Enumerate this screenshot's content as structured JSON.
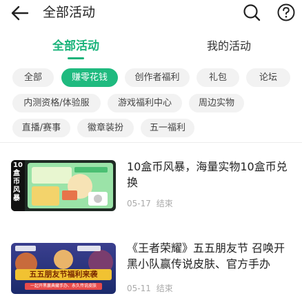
{
  "header": {
    "title": "全部活动",
    "icons": {
      "back": "back-arrow-icon",
      "search": "search-icon",
      "help": "help-icon"
    }
  },
  "tabs": [
    {
      "label": "全部活动",
      "active": true
    },
    {
      "label": "我的活动",
      "active": false
    }
  ],
  "categories": [
    {
      "label": "全部",
      "active": false
    },
    {
      "label": "赚零花钱",
      "active": true
    },
    {
      "label": "创作者福利",
      "active": false
    },
    {
      "label": "礼包",
      "active": false
    },
    {
      "label": "论坛",
      "active": false
    },
    {
      "label": "内测资格/体验服",
      "active": false
    },
    {
      "label": "游戏福利中心",
      "active": false
    },
    {
      "label": "周边实物",
      "active": false
    },
    {
      "label": "直播/赛事",
      "active": false
    },
    {
      "label": "徽章装扮",
      "active": false
    },
    {
      "label": "五一福利",
      "active": false
    }
  ],
  "activities": [
    {
      "title": "10盒币风暴，海量实物10盒币兑换",
      "date": "05-17",
      "status": "结束",
      "thumb_text": "10盒币风暴"
    },
    {
      "title": "《王者荣耀》五五朋友节 召唤开黑小队赢传说皮肤、官方手办",
      "date": "05-11",
      "status": "结束",
      "thumb_text": "五五朋友节福利来袭",
      "thumb_subtext": "一起开黑赢典藏手办、永久传说皮肤"
    }
  ],
  "colors": {
    "accent": "#1fba7f",
    "tab_active": "#19b37a",
    "chip_bg": "#f2f2f2"
  }
}
